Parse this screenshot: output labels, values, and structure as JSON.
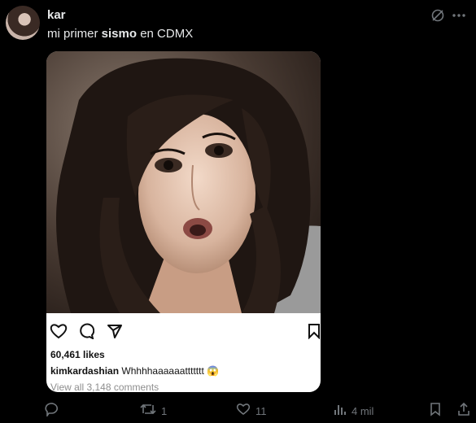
{
  "post": {
    "username": "kar",
    "text_before": "mi primer ",
    "text_bold": "sismo",
    "text_after": " en CDMX"
  },
  "embedded_ig": {
    "likes": "60,461 likes",
    "caption_user": "kimkardashian",
    "caption_text": "Whhhhaaaaaattttttt",
    "caption_emoji": "😱",
    "view_all": "View all 3,148 comments"
  },
  "action_bar": {
    "reposts": "1",
    "likes": "11",
    "views": "4 mil"
  },
  "icons": {
    "top": [
      "grok-icon",
      "more-icon"
    ],
    "ig": [
      "heart-icon",
      "comment-icon",
      "share-icon",
      "bookmark-icon"
    ],
    "bar": [
      "reply-icon",
      "repost-icon",
      "like-icon",
      "views-icon",
      "bookmark-icon",
      "share-icon"
    ]
  },
  "colors": {
    "background": "#000000",
    "text": "#e7e9ea",
    "muted": "#71767b"
  }
}
